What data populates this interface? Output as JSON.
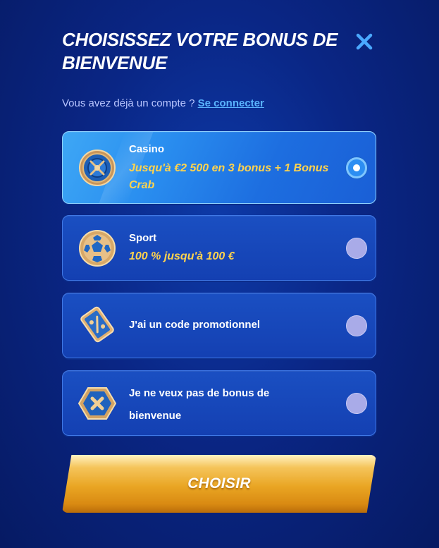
{
  "header": {
    "title": "CHOISISSEZ VOTRE BONUS DE BIENVENUE",
    "close_icon": "close-icon"
  },
  "login": {
    "prompt": "Vous avez déjà un compte ?",
    "link": "Se connecter"
  },
  "options": [
    {
      "label": "Casino",
      "bonus": "Jusqu'à €2 500 en 3 bonus + 1 Bonus Crab",
      "icon": "roulette-icon",
      "selected": true
    },
    {
      "label": "Sport",
      "bonus": "100 % jusqu'à 100 €",
      "icon": "football-icon",
      "selected": false
    },
    {
      "label": "J'ai un code promotionnel",
      "icon": "promo-ticket-icon",
      "selected": false
    },
    {
      "label": "Je ne veux pas de bonus de bienvenue",
      "icon": "no-bonus-icon",
      "selected": false
    }
  ],
  "submit": {
    "label": "CHOISIR"
  },
  "colors": {
    "accent": "#ffd34d",
    "link": "#5ab4ff",
    "selected_option": "#2a8ff0",
    "option": "#1440b2",
    "button": "#e9a523"
  }
}
